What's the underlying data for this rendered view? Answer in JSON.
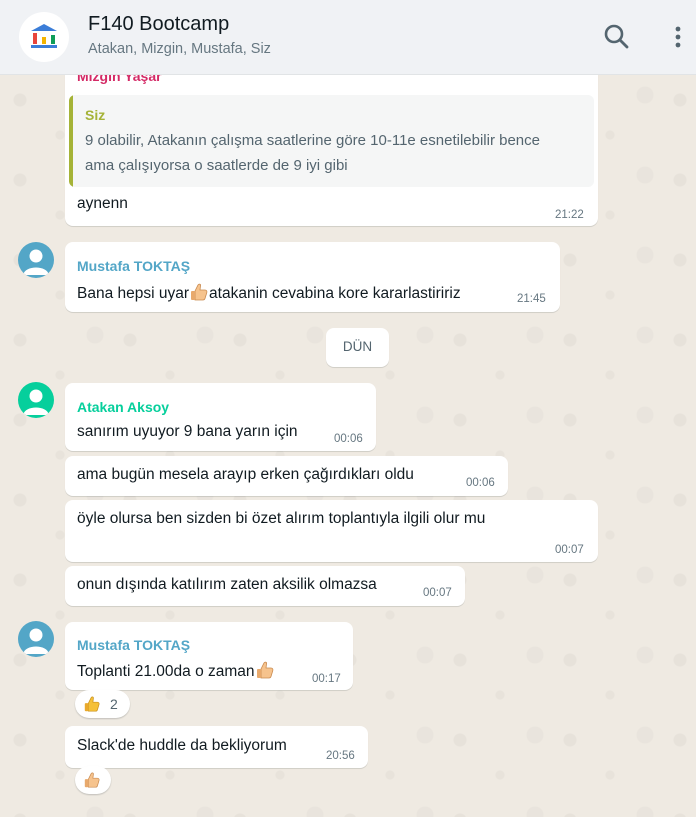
{
  "header": {
    "title": "F140 Bootcamp",
    "subtitle": "Atakan, Mizgin, Mustafa, Siz",
    "search_icon": "search-icon",
    "menu_icon": "kebab-menu-icon"
  },
  "messages": {
    "m1": {
      "sender": "Mizgin Yaşar",
      "quote_author": "Siz",
      "quote_line1": "9 olabilir, Atakanın çalışma saatlerine göre 10-11e esnetilebilir bence",
      "quote_line2": "ama çalışıyorsa o saatlerde de 9 iyi gibi",
      "text": "aynenn",
      "time": "21:22"
    },
    "m2": {
      "sender": "Mustafa TOKTAŞ",
      "text_before": "Bana hepsi uyar",
      "text_after": "atakanin cevabina kore kararlastiririz",
      "time": "21:45"
    },
    "date_divider": "DÜN",
    "m3": {
      "sender": "Atakan Aksoy",
      "text": "sanırım uyuyor 9 bana yarın için",
      "time": "00:06"
    },
    "m4": {
      "text": "ama bugün mesela arayıp erken çağırdıkları oldu",
      "time": "00:06"
    },
    "m5": {
      "text": "öyle olursa ben sizden bi özet alırım toplantıyla ilgili olur mu",
      "time": "00:07"
    },
    "m6": {
      "text": "onun dışında katılırım zaten aksilik olmazsa",
      "time": "00:07"
    },
    "m7": {
      "sender": "Mustafa TOKTAŞ",
      "text": "Toplanti 21.00da o zaman",
      "time": "00:17",
      "reaction_count": "2"
    },
    "m8": {
      "text": "Slack'de huddle da bekliyorum",
      "time": "20:56"
    }
  },
  "colors": {
    "mizgin": "#d42a66",
    "mustafa": "#53a6c7",
    "atakan": "#06cf9c",
    "quote_accent": "#a5b337"
  }
}
